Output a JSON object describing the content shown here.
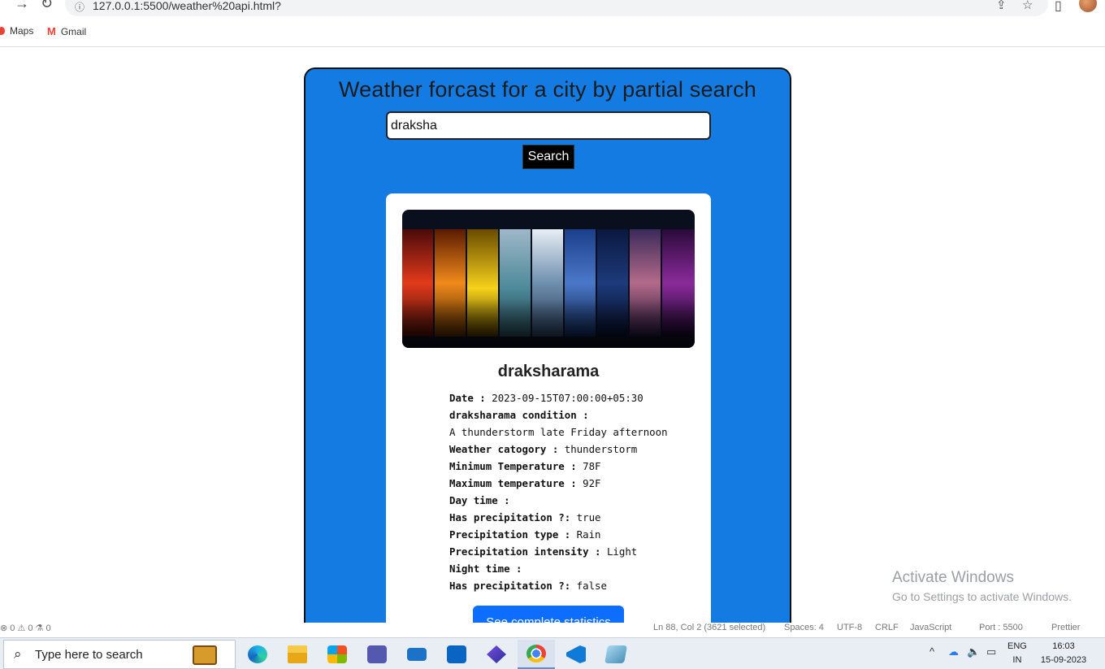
{
  "browser": {
    "url": "127.0.0.1:5500/weather%20api.html?",
    "bookmarks": [
      "Maps",
      "Gmail"
    ]
  },
  "page": {
    "heading": "Weather forcast for a city by partial search",
    "search": {
      "value": "draksha",
      "button_label": "Search"
    },
    "result": {
      "city": "draksharama",
      "lines": [
        {
          "label": "Date :",
          "value": "2023-09-15T07:00:00+05:30"
        },
        {
          "label": "draksharama condition :",
          "value": ""
        },
        {
          "label": "",
          "value": "A thunderstorm late Friday afternoon"
        },
        {
          "label": "Weather catogory :",
          "value": " thunderstorm"
        },
        {
          "label": "Minimum Temperature :",
          "value": " 78F"
        },
        {
          "label": "Maximum temperature :",
          "value": " 92F"
        },
        {
          "label": "Day time :",
          "value": ""
        },
        {
          "label": "Has precipitation ?:",
          "value": " true"
        },
        {
          "label": "Precipitation type :",
          "value": " Rain"
        },
        {
          "label": "Precipitation intensity :",
          "value": " Light"
        },
        {
          "label": "Night time :",
          "value": ""
        },
        {
          "label": "Has precipitation ?:",
          "value": " false"
        }
      ],
      "stats_button": "See complete statistics"
    }
  },
  "watermark": {
    "title": "Activate Windows",
    "subtitle": "Go to Settings to activate Windows."
  },
  "editor_status": {
    "left": "⊗ 0 ⚠ 0    ⚗ 0",
    "position": "Ln 88, Col 2 (3621 selected)",
    "spaces": "Spaces: 4",
    "encoding": "UTF-8",
    "eol": "CRLF",
    "language": "JavaScript",
    "port": "Port : 5500",
    "formatter": "Prettier"
  },
  "taskbar": {
    "search_placeholder": "Type here to search",
    "lang_line1": "ENG",
    "lang_line2": "IN",
    "time": "16:03",
    "date": "15-09-2023"
  },
  "colors": {
    "panel": "#137be2",
    "button_primary": "#0d6efd"
  }
}
